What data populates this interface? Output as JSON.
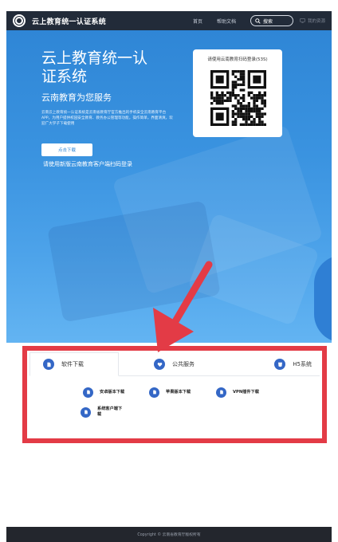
{
  "header": {
    "brand": "云上教育统一认证系统",
    "nav": [
      "首页",
      "帮助文档"
    ],
    "search_label": "搜索",
    "console_label": "我的资源"
  },
  "hero": {
    "title": "云上教育统一认证系统",
    "subtitle": "云南教育为您服务",
    "description": "云南云上教育统一认证系统是云南省教育厅官方推出的手机安全云南教育平台APP，为用户提供校园安全教育、教务办公管理等功能，操作简单，界面清爽，欢迎广大学子下载使用",
    "download_button": "点击下载",
    "note": "请使用新版云南教育客户端扫码登录",
    "qr_title": "请使用云南教育扫码登录(53S)"
  },
  "tabs": [
    {
      "label": "软件下载",
      "icon": "download-file-icon",
      "active": true
    },
    {
      "label": "公共服务",
      "icon": "heart-shield-icon",
      "active": false
    },
    {
      "label": "H5系统",
      "icon": "html5-icon",
      "active": false
    }
  ],
  "downloads": [
    {
      "label": "安卓版本下载",
      "icon": "android-file-icon"
    },
    {
      "label": "苹果版本下载",
      "icon": "apple-file-icon"
    },
    {
      "label": "VPN插件下载",
      "icon": "vpn-file-icon"
    },
    {
      "label": "系统客户端下载",
      "icon": "client-file-icon"
    }
  ],
  "footer": {
    "copyright": "Copyright © 云南省教育厅版权所有"
  },
  "colors": {
    "accent": "#3467c6",
    "hero": "#2f86d6",
    "annotation": "#e33b46",
    "nav": "#222b39"
  }
}
